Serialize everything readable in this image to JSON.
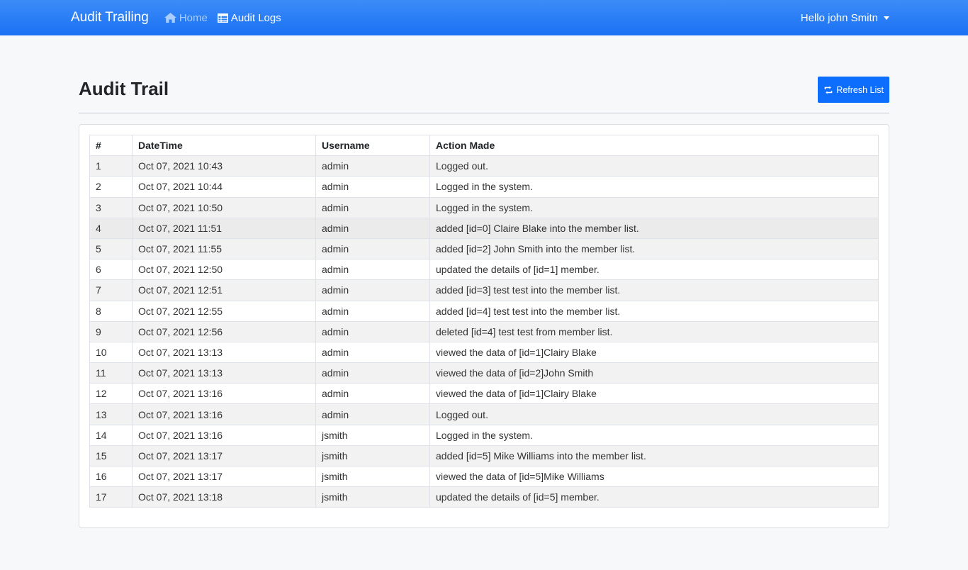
{
  "navbar": {
    "brand": "Audit Trailing",
    "home_label": "Home",
    "logs_label": "Audit Logs",
    "user_label": "Hello john Smitn"
  },
  "page": {
    "title": "Audit Trail",
    "refresh_label": "Refresh List"
  },
  "table": {
    "headers": [
      "#",
      "DateTime",
      "Username",
      "Action Made"
    ],
    "rows": [
      [
        "1",
        "Oct 07, 2021 10:43",
        "admin",
        "Logged out."
      ],
      [
        "2",
        "Oct 07, 2021 10:44",
        "admin",
        "Logged in the system."
      ],
      [
        "3",
        "Oct 07, 2021 10:50",
        "admin",
        "Logged in the system."
      ],
      [
        "4",
        "Oct 07, 2021 11:51",
        "admin",
        "added [id=0] Claire Blake into the member list."
      ],
      [
        "5",
        "Oct 07, 2021 11:55",
        "admin",
        "added [id=2] John Smith into the member list."
      ],
      [
        "6",
        "Oct 07, 2021 12:50",
        "admin",
        "updated the details of [id=1] member."
      ],
      [
        "7",
        "Oct 07, 2021 12:51",
        "admin",
        "added [id=3] test test into the member list."
      ],
      [
        "8",
        "Oct 07, 2021 12:55",
        "admin",
        "added [id=4] test test into the member list."
      ],
      [
        "9",
        "Oct 07, 2021 12:56",
        "admin",
        "deleted [id=4] test test from member list."
      ],
      [
        "10",
        "Oct 07, 2021 13:13",
        "admin",
        "viewed the data of [id=1]Clairy Blake"
      ],
      [
        "11",
        "Oct 07, 2021 13:13",
        "admin",
        "viewed the data of [id=2]John Smith"
      ],
      [
        "12",
        "Oct 07, 2021 13:16",
        "admin",
        "viewed the data of [id=1]Clairy Blake"
      ],
      [
        "13",
        "Oct 07, 2021 13:16",
        "admin",
        "Logged out."
      ],
      [
        "14",
        "Oct 07, 2021 13:16",
        "jsmith",
        "Logged in the system."
      ],
      [
        "15",
        "Oct 07, 2021 13:17",
        "jsmith",
        "added [id=5] Mike Williams into the member list."
      ],
      [
        "16",
        "Oct 07, 2021 13:17",
        "jsmith",
        "viewed the data of [id=5]Mike Williams"
      ],
      [
        "17",
        "Oct 07, 2021 13:18",
        "jsmith",
        "updated the details of [id=5] member."
      ]
    ],
    "hovered_row": 4
  },
  "icons": {
    "home": "home-icon",
    "logs": "table-icon",
    "refresh": "refresh-icon"
  },
  "colors": {
    "navbar": "#1a71f3",
    "button": "#0d6efd",
    "striped_row": "#f2f2f2"
  }
}
